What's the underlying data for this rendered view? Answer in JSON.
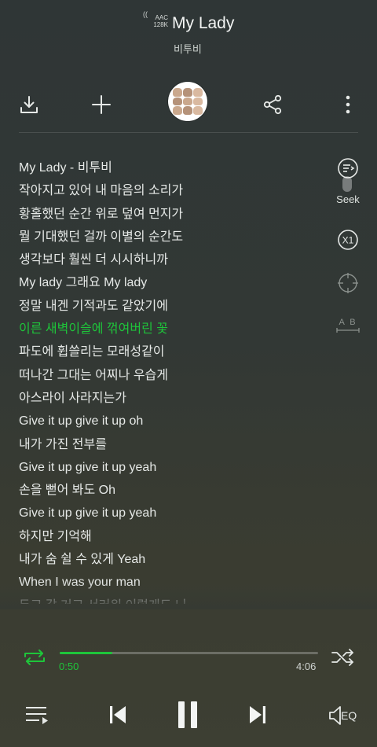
{
  "header": {
    "codec_line1": "AAC",
    "codec_line2": "128K",
    "title": "My Lady",
    "artist": "비투비"
  },
  "toolbar": {
    "icons": [
      "download-icon",
      "plus-icon",
      "album-art",
      "share-icon",
      "more-vertical-icon"
    ]
  },
  "lyrics": {
    "lines": [
      "My Lady - 비투비",
      "작아지고 있어 내 마음의 소리가",
      "황홀했던 순간 위로 덮여 먼지가",
      "뭘 기대했던 걸까 이별의 순간도",
      "생각보다 훨씬 더 시시하니까",
      "My lady 그래요 My lady",
      "정말 내겐 기적과도 같았기에",
      "이른 새벽이슬에 꺾여버린 꽃",
      "파도에 휩쓸리는 모래성같이",
      "떠나간 그대는 어찌나 우습게",
      "아스라이 사라지는가",
      "Give it up give it up oh",
      "내가 가진 전부를",
      "Give it up give it up yeah",
      "손을 뻗어 봐도 Oh",
      "Give it up give it up yeah",
      "하지만 기억해",
      "내가 숨 쉴 수 있게 Yeah",
      "When I was your man",
      "두고 갈 거고 서러워 이렇게도 니"
    ],
    "active_index": 7
  },
  "side_tools": {
    "seek_label": "Seek",
    "speed_label": "X1"
  },
  "player": {
    "current_time": "0:50",
    "total_time": "4:06",
    "progress": 0.2033,
    "eq_label": "EQ"
  },
  "colors": {
    "accent": "#1ec53a",
    "text": "#e6e9e7"
  }
}
